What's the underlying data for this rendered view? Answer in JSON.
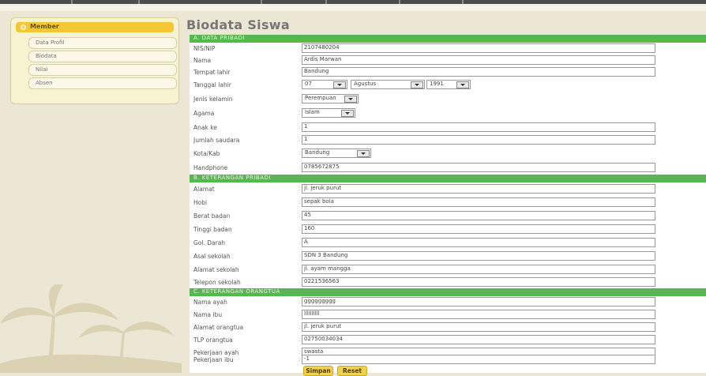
{
  "sidebar": {
    "header": "Member",
    "items": [
      {
        "label": "Data Profil"
      },
      {
        "label": "Biodata"
      },
      {
        "label": "Nilai"
      },
      {
        "label": "Absen"
      }
    ]
  },
  "page": {
    "title": "Biodata Siswa"
  },
  "sections": {
    "a": "A. DATA PRIBADI",
    "b": "B. KETERANGAN PRIBADI",
    "c": "C. KETERANGAN ORANGTUA"
  },
  "form": {
    "nis": {
      "label": "NIS/NIP",
      "value": "2107480204"
    },
    "nama": {
      "label": "Nama",
      "value": "Ardis Marwan"
    },
    "tempat": {
      "label": "Tempat lahir",
      "value": "Bandung"
    },
    "tanggal": {
      "label": "Tanggal lahir",
      "day": "07",
      "month": "Agustus",
      "year": "1991"
    },
    "jk": {
      "label": "Jenis kelamin",
      "value": "Perempuan"
    },
    "agama": {
      "label": "Agama",
      "value": "Islam"
    },
    "anak": {
      "label": "Anak ke",
      "value": "1"
    },
    "saudara": {
      "label": "Jumlah saudara",
      "value": "1"
    },
    "kota": {
      "label": "Kota/Kab",
      "value": "Bandung"
    },
    "hp": {
      "label": "Handphone",
      "value": "0785672875"
    },
    "alamat": {
      "label": "Alamat",
      "value": "jl. jeruk purut"
    },
    "hobi": {
      "label": "Hobi",
      "value": "sepak bola"
    },
    "berat": {
      "label": "Berat badan",
      "value": "45"
    },
    "tinggi": {
      "label": "Tinggi badan",
      "value": "160"
    },
    "goldar": {
      "label": "Gol. Darah",
      "value": "A"
    },
    "asal": {
      "label": "Asal sekolah",
      "value": "SDN 3 Bandung"
    },
    "alamat_sek": {
      "label": "Alamat sekolah",
      "value": "jl. ayam mangga"
    },
    "telp_sek": {
      "label": "Telepon sekolah",
      "value": "0221536563"
    },
    "ayah": {
      "label": "Nama ayah",
      "value": "ggggggggg"
    },
    "ibu": {
      "label": "Nama ibu",
      "value": "llllllllll"
    },
    "alamat_ortu": {
      "label": "Alamat orangtua",
      "value": "jl. jeruk purut"
    },
    "telp_ortu": {
      "label": "TLP orangtua",
      "value": "02750034034"
    },
    "kerja_ayah": {
      "label": "Pekerjaan ayah",
      "value": "swasta"
    },
    "kerja_ibu": {
      "label": "Pekerjaan ibu",
      "value": "-1"
    }
  },
  "buttons": {
    "save": "Simpan",
    "reset": "Reset"
  }
}
